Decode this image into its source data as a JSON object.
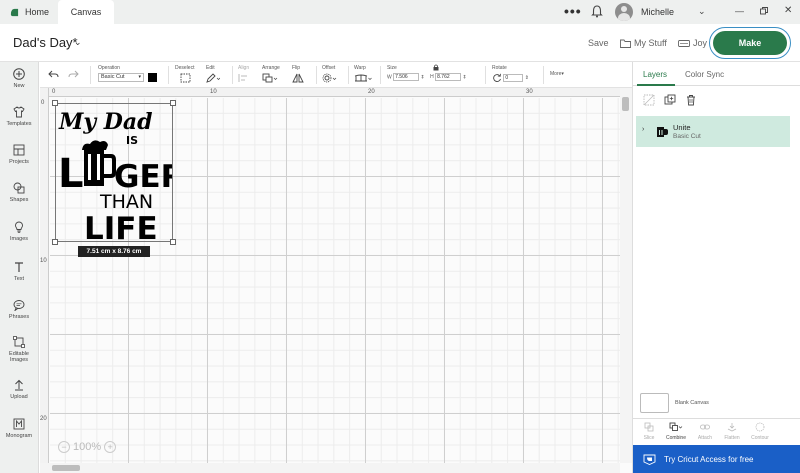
{
  "titlebar": {
    "tabs": [
      {
        "label": "Home"
      },
      {
        "label": "Canvas"
      }
    ],
    "username": "Michelle"
  },
  "header": {
    "project_title": "Dad's Day*",
    "save_label": "Save",
    "mystuff_label": "My Stuff",
    "joy_label": "Joy",
    "make_label": "Make"
  },
  "sidebar": {
    "items": [
      {
        "label": "New",
        "icon": "plus-icon"
      },
      {
        "label": "Templates",
        "icon": "shirt-icon"
      },
      {
        "label": "Projects",
        "icon": "projects-icon"
      },
      {
        "label": "Shapes",
        "icon": "shapes-icon"
      },
      {
        "label": "Images",
        "icon": "bulb-icon"
      },
      {
        "label": "Text",
        "icon": "text-icon"
      },
      {
        "label": "Phrases",
        "icon": "chat-icon"
      },
      {
        "label": "Editable Images",
        "icon": "editable-images-icon"
      },
      {
        "label": "Upload",
        "icon": "upload-icon"
      },
      {
        "label": "Monogram",
        "icon": "monogram-icon"
      }
    ]
  },
  "toolbar": {
    "operation_label": "Operation",
    "operation_value": "Basic Cut",
    "deselect_label": "Deselect",
    "edit_label": "Edit",
    "align_label": "Align",
    "arrange_label": "Arrange",
    "flip_label": "Flip",
    "offset_label": "Offset",
    "warp_label": "Warp",
    "size_label": "Size",
    "w_label": "W",
    "w_value": "7.506",
    "h_label": "H",
    "h_value": "8.762",
    "rotate_label": "Rotate",
    "rotate_value": "0",
    "more_label": "More"
  },
  "canvas": {
    "ruler_top": [
      "0",
      "10",
      "20",
      "30"
    ],
    "ruler_left": [
      "0",
      "10",
      "20"
    ],
    "design_lines": [
      "My Dad",
      "IS",
      "L",
      "GER",
      "THAN",
      "LIFE"
    ],
    "dimension_label": "7.51  cm x 8.76  cm",
    "zoom_value": "100%"
  },
  "panel": {
    "tabs": [
      {
        "label": "Layers"
      },
      {
        "label": "Color Sync"
      }
    ],
    "layer": {
      "name": "Unite",
      "sub": "Basic Cut"
    },
    "blank_canvas_label": "Blank Canvas",
    "tools": [
      {
        "label": "Slice",
        "icon": "slice-icon"
      },
      {
        "label": "Combine",
        "icon": "combine-icon"
      },
      {
        "label": "Attach",
        "icon": "attach-icon"
      },
      {
        "label": "Flatten",
        "icon": "flatten-icon"
      },
      {
        "label": "Contour",
        "icon": "contour-icon"
      }
    ],
    "access_label": "Try Cricut Access for free"
  },
  "colors": {
    "accent": "#2a7a4b",
    "layer_highlight": "#cfeadf",
    "access_banner": "#1a5fc7"
  }
}
